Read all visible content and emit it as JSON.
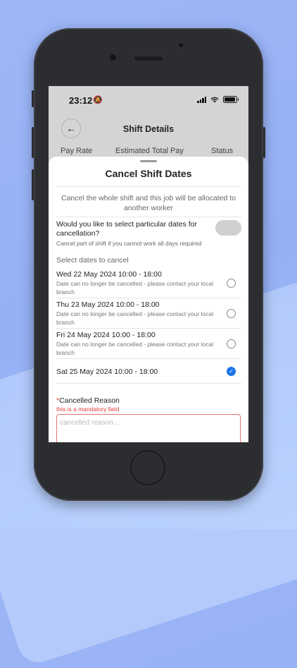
{
  "status_bar": {
    "time": "23:12"
  },
  "header": {
    "title": "Shift Details"
  },
  "columns": [
    "Pay Rate",
    "Estimated Total Pay",
    "Status"
  ],
  "sheet": {
    "title": "Cancel Shift Dates",
    "cancel_whole_text": "Cancel the whole shift and this job will be allocated to another worker",
    "select_question": "Would you like to select particular dates for cancellation?",
    "select_hint": "Cancel part of shift if you cannot work all days required",
    "toggle_on": false,
    "select_dates_label": "Select dates to cancel",
    "dates": [
      {
        "date": "Wed 22 May 2024 10:00 - 18:00",
        "note": "Date can no longer be cancelled - please contact your local branch",
        "selected": false
      },
      {
        "date": "Thu 23 May 2024 10:00 - 18:00",
        "note": "Date can no longer be cancelled - please contact your local branch",
        "selected": false
      },
      {
        "date": "Fri 24 May 2024 10:00 - 18:00",
        "note": "Date can no longer be cancelled - please contact your local branch",
        "selected": false
      },
      {
        "date": "Sat 25 May 2024 10:00 - 18:00",
        "note": "",
        "selected": true
      }
    ],
    "reason": {
      "required_mark": "*",
      "label": "Cancelled Reason",
      "error": "this is a mandatory field",
      "placeholder": "cancelled reason...",
      "value": ""
    }
  },
  "colors": {
    "accent": "#1a73e8",
    "error": "#e53935",
    "background": "#9db6f7"
  }
}
